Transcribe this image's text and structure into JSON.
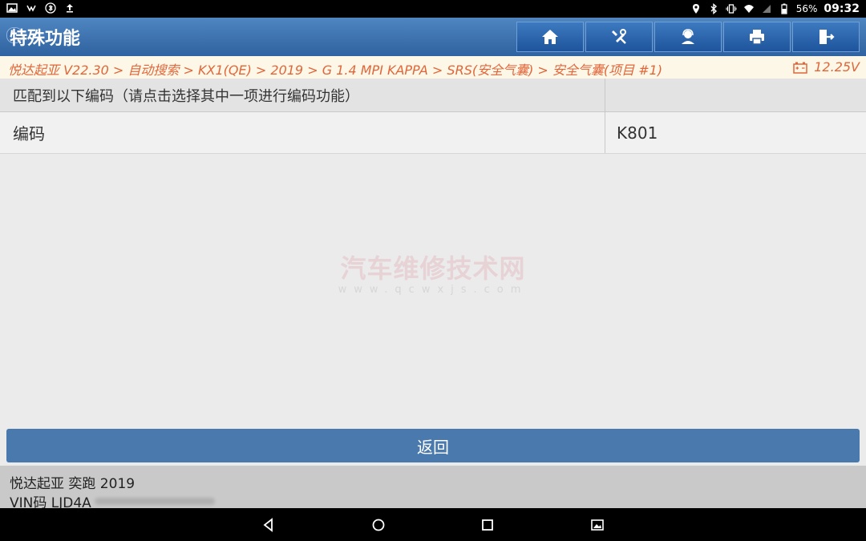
{
  "status_bar": {
    "battery": "56%",
    "time": "09:32"
  },
  "header": {
    "title": "特殊功能",
    "toolbar": [
      "home-button",
      "tools-button",
      "support-button",
      "print-button",
      "exit-button"
    ]
  },
  "breadcrumb": {
    "path": "悦达起亚 V22.30 > 自动搜索 > KX1(QE) > 2019 > G 1.4 MPI KAPPA > SRS(安全气囊) > 安全气囊(项目 #1)",
    "voltage": "12.25V"
  },
  "table": {
    "header": {
      "left": "匹配到以下编码（请点击选择其中一项进行编码功能）",
      "right": ""
    },
    "rows": [
      {
        "left": "编码",
        "right": "K801"
      }
    ]
  },
  "watermark": {
    "line1": "汽车维修技术网",
    "line2": "www.qcwxjs.com"
  },
  "back_button": {
    "label": "返回"
  },
  "vehicle_info": {
    "line1": "悦达起亚 奕跑 2019",
    "line2": "VIN码 LJD4A"
  },
  "colors": {
    "header": "#2f62a0",
    "breadcrumb_text": "#e0663a",
    "back_button": "#4a79ad"
  }
}
